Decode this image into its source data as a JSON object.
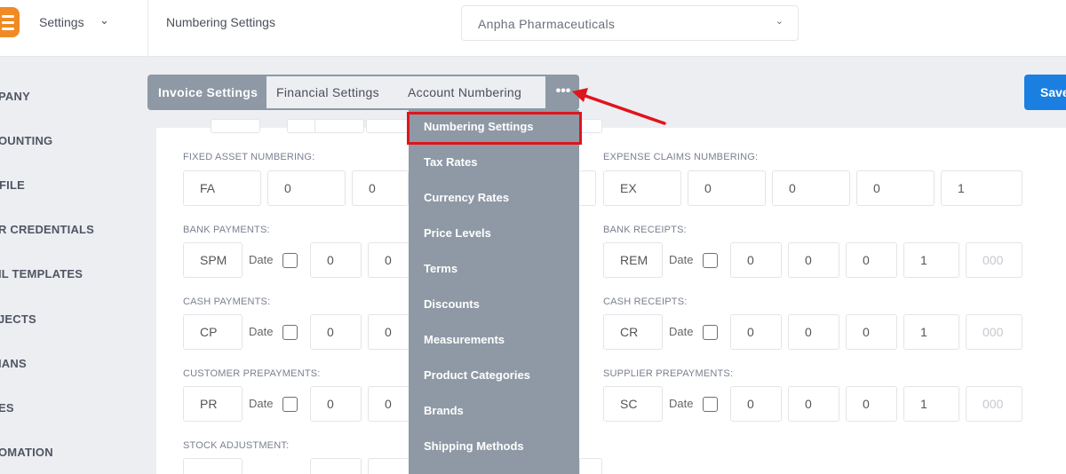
{
  "header": {
    "settings_label": "Settings",
    "page_title": "Numbering Settings",
    "company": "Anpha Pharmaceuticals"
  },
  "sidebar": {
    "items": [
      "PANY",
      "OUNTING",
      "FILE",
      "R CREDENTIALS",
      "IL TEMPLATES",
      "JECTS",
      "IANS",
      "ES",
      "OMATION"
    ]
  },
  "tabs": {
    "invoice": "Invoice Settings",
    "financial": "Financial Settings",
    "account": "Account Numbering",
    "more": "•••"
  },
  "save_label": "Save",
  "menu": {
    "items": [
      "Numbering Settings",
      "Tax Rates",
      "Currency Rates",
      "Price Levels",
      "Terms",
      "Discounts",
      "Measurements",
      "Product Categories",
      "Brands",
      "Shipping Methods"
    ]
  },
  "form": {
    "fixed_asset": {
      "label": "FIXED ASSET NUMBERING:",
      "prefix": "FA",
      "v1": "0",
      "v2": "0"
    },
    "expense_claims": {
      "label": "EXPENSE CLAIMS NUMBERING:",
      "prefix": "EX",
      "v1": "0",
      "v2": "0",
      "v3": "0",
      "v4": "1"
    },
    "bank_payments": {
      "label": "BANK PAYMENTS:",
      "prefix": "SPM",
      "date": "Date",
      "v1": "0",
      "v2": "0"
    },
    "bank_receipts": {
      "label": "BANK RECEIPTS:",
      "prefix": "REM",
      "date": "Date",
      "v1": "0",
      "v2": "0",
      "v3": "0",
      "v4": "1",
      "placeholder": "000"
    },
    "cash_payments": {
      "label": "CASH PAYMENTS:",
      "prefix": "CP",
      "date": "Date",
      "v1": "0",
      "v2": "0"
    },
    "cash_receipts": {
      "label": "CASH RECEIPTS:",
      "prefix": "CR",
      "date": "Date",
      "v1": "0",
      "v2": "0",
      "v3": "0",
      "v4": "1",
      "placeholder": "000"
    },
    "customer_prepayments": {
      "label": "CUSTOMER PREPAYMENTS:",
      "prefix": "PR",
      "date": "Date",
      "v1": "0",
      "v2": "0"
    },
    "supplier_prepayments": {
      "label": "SUPPLIER PREPAYMENTS:",
      "prefix": "SC",
      "date": "Date",
      "v1": "0",
      "v2": "0",
      "v3": "0",
      "v4": "1",
      "placeholder": "000"
    },
    "stock_adjustment": {
      "label": "STOCK ADJUSTMENT:"
    }
  },
  "colors": {
    "accent": "#1a7fe0",
    "menu_bg": "#8e99a5",
    "highlight": "#e0141c",
    "logo": "#f08a24"
  }
}
